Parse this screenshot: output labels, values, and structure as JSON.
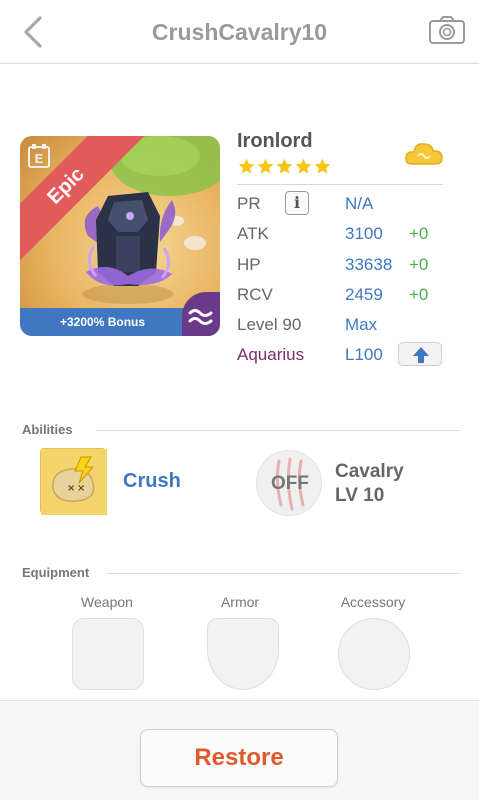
{
  "header": {
    "title": "CrushCavalry10",
    "back_icon": "chevron-left-icon",
    "camera_icon": "camera-icon"
  },
  "hero": {
    "rarity": "Epic",
    "bonus": "+3200% Bonus",
    "element_icon": "water-wave-icon",
    "colors": {
      "ribbon": "#e15b5b",
      "bonus_bar": "#3f78c0",
      "element_corner": "#6a3a8a"
    }
  },
  "unit": {
    "name": "Ironlord",
    "stars": 5,
    "stats": [
      {
        "label": "PR",
        "value": "N/A",
        "plus": ""
      },
      {
        "label": "ATK",
        "value": "3100",
        "plus": "+0"
      },
      {
        "label": "HP",
        "value": "33638",
        "plus": "+0"
      },
      {
        "label": "RCV",
        "value": "2459",
        "plus": "+0"
      },
      {
        "label": "Level 90",
        "value": "Max",
        "plus": ""
      },
      {
        "label": "Aquarius",
        "value": "L100",
        "plus": ""
      }
    ],
    "colors": {
      "value": "#3f78c0",
      "plus": "#4caf50",
      "aquarius": "#7a2e6e",
      "star": "#f5c518"
    }
  },
  "abilities": {
    "section_title": "Abilities",
    "ability_name": "Crush",
    "skill_status": "OFF",
    "skill_name": "Cavalry",
    "skill_level": "LV 10"
  },
  "equipment": {
    "section_title": "Equipment",
    "slots": [
      "Weapon",
      "Armor",
      "Accessory"
    ]
  },
  "footer": {
    "restore_label": "Restore",
    "restore_color": "#dc5a2e"
  }
}
